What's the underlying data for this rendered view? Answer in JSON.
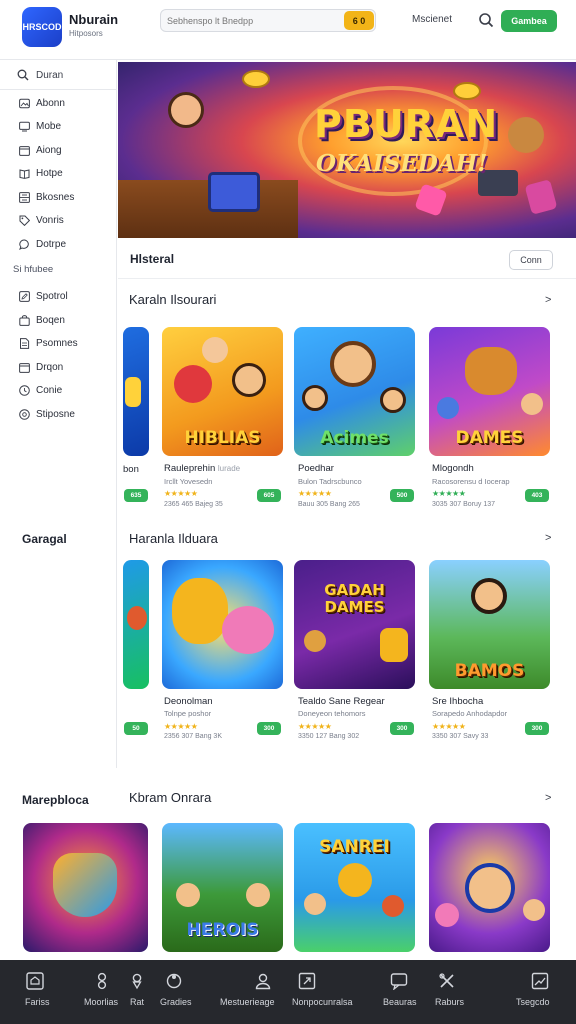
{
  "header": {
    "logo_text": "HRSCOD",
    "brand_name": "Nburain",
    "brand_sub": "Hitposors",
    "search_placeholder": "Sebhenspo lt Bnedpp",
    "search_button": "6 0",
    "top_link": "Mscienet",
    "cta_label": "Gambea"
  },
  "sidebar": {
    "search_label": "Duran",
    "items_a": [
      {
        "label": "Abonn",
        "icon": "image-icon"
      },
      {
        "label": "Mobe",
        "icon": "tv-icon"
      },
      {
        "label": "Aiong",
        "icon": "calendar-icon"
      },
      {
        "label": "Hotpe",
        "icon": "book-icon"
      },
      {
        "label": "Bkosnes",
        "icon": "grid-icon"
      },
      {
        "label": "Vonris",
        "icon": "tag-icon"
      },
      {
        "label": "Dotrpe",
        "icon": "chat-icon"
      }
    ],
    "section_label": "Si hfubee",
    "items_b": [
      {
        "label": "Spotrol",
        "icon": "pencil-icon"
      },
      {
        "label": "Boqen",
        "icon": "bag-icon"
      },
      {
        "label": "Psomnes",
        "icon": "document-icon"
      },
      {
        "label": "Drqon",
        "icon": "calendar-icon"
      },
      {
        "label": "Conie",
        "icon": "clock-icon"
      },
      {
        "label": "Stiposne",
        "icon": "gear-icon"
      }
    ]
  },
  "hero": {
    "title_line1": "PBURAN",
    "title_line2": "OKAISEDAH!"
  },
  "history_row": {
    "title": "Hlsteral",
    "button": "Conn"
  },
  "sections": [
    {
      "title": "Karaln Ilsourari",
      "arrow": ">",
      "left_label": "",
      "cards": [
        {
          "name": "",
          "sub": "",
          "stars": "",
          "pill": "",
          "meta": "",
          "thumb_text": ""
        },
        {
          "name": "Rauleprehin",
          "badge": "lurade",
          "sub": "Ircllt Yovesedn",
          "stars": "★★★★★",
          "pill": "605",
          "meta": "2365 465   Bajeg 35",
          "thumb_text": "HIBLIAS"
        },
        {
          "name": "Poedhar",
          "sub": "Bulon Tadrscbunco",
          "stars": "★★★★★",
          "pill": "500",
          "meta": "Bauu 305   Bang 265",
          "thumb_text": "Acimes"
        },
        {
          "name": "Mlogondh",
          "sub": "Racosorensu d Iocerap",
          "stars": "★★★★★",
          "pill": "403",
          "meta": "3035 307   Boruy 137",
          "thumb_text": "DAMES"
        }
      ]
    },
    {
      "title": "Haranla Ilduara",
      "arrow": ">",
      "left_label": "Garagal",
      "cards": [
        {
          "name": "",
          "sub": "",
          "stars": "",
          "pill": "",
          "meta": "",
          "thumb_text": ""
        },
        {
          "name": "Deonolman",
          "sub": "Tolnpe poshor",
          "stars": "★★★★★",
          "pill": "300",
          "meta": "2356 307   Bang 3K",
          "thumb_text": ""
        },
        {
          "name": "Tealdo Sane Regear",
          "sub": "Doneyeon tehomors",
          "stars": "★★★★★",
          "pill": "300",
          "meta": "3350 127   Bang 302",
          "thumb_text": "GADAH DAMES"
        },
        {
          "name": "Sre Ihbocha",
          "sub": "Sorapedo Anhodapdor",
          "stars": "★★★★★",
          "pill": "300",
          "meta": "3350 307   Savy 33",
          "thumb_text": "BAMOS"
        }
      ]
    },
    {
      "title": "Kbram Onrara",
      "arrow": ">",
      "left_label": "Marepbloca",
      "cards": [
        {
          "thumb_text": ""
        },
        {
          "thumb_text": "HEROIS"
        },
        {
          "thumb_text": "SANREI"
        },
        {
          "thumb_text": ""
        }
      ]
    }
  ],
  "bottom_nav": [
    {
      "label": "Fariss",
      "icon": "home-icon"
    },
    {
      "label": "Moorlias",
      "icon": "person-icon"
    },
    {
      "label": "Rat",
      "icon": "at-icon"
    },
    {
      "label": "Gradies",
      "icon": "puzzle-icon"
    },
    {
      "label": "Mestuerieage",
      "icon": "user-icon"
    },
    {
      "label": "Nonpocunralsa",
      "icon": "external-icon"
    },
    {
      "label": "Beauras",
      "icon": "chat-bubble-icon"
    },
    {
      "label": "Raburs",
      "icon": "tools-icon"
    },
    {
      "label": "Tsegcdo",
      "icon": "trend-icon"
    }
  ],
  "colors": {
    "accent_green": "#2fae55",
    "accent_yellow": "#f2b418",
    "brand_blue": "#2f66ff",
    "nav_bg": "#26282d"
  }
}
